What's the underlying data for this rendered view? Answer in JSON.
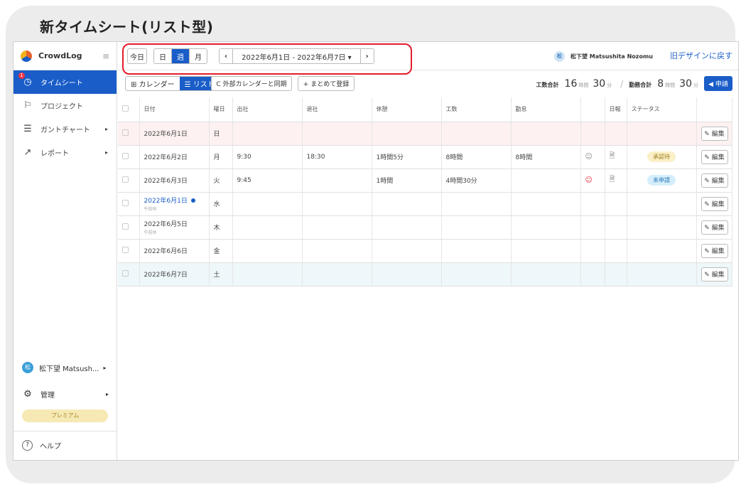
{
  "page_title": "新タイムシート(リスト型)",
  "sidebar": {
    "logo": "CrowdLog",
    "items": [
      {
        "label": "タイムシート",
        "icon": "clock-icon",
        "active": true,
        "badge": "1"
      },
      {
        "label": "プロジェクト",
        "icon": "flag-icon"
      },
      {
        "label": "ガントチャート",
        "icon": "gantt-icon",
        "chevron": "▸"
      },
      {
        "label": "レポート",
        "icon": "trend-icon",
        "chevron": "▸"
      }
    ],
    "user": {
      "avatar": "松",
      "name": "松下望 Matsush...",
      "chevron": "▸"
    },
    "admin": {
      "label": "管理",
      "chevron": "▸"
    },
    "premium": "プレミアム",
    "help": "ヘルプ"
  },
  "topbar": {
    "today": "今日",
    "views": [
      "日",
      "週",
      "月"
    ],
    "active_view": "週",
    "prev": "‹",
    "next": "›",
    "range": "2022年6月1日 - 2022年6月7日 ▾",
    "user_avatar": "松",
    "user_name": "松下望 Matsushita Nozomu",
    "old_design": "旧デザインに戻す"
  },
  "toolbar": {
    "calendar": "⊞ カレンダー",
    "list": "☰ リスト",
    "sync": "C 外部カレンダーと同期",
    "bulk": "+ まとめて登録",
    "work_total_label": "工数合計",
    "work_hours": "16",
    "work_minutes": "30",
    "attend_total_label": "勤務合計",
    "attend_hours": "8",
    "attend_minutes": "30",
    "hour_unit": "時間",
    "min_unit": "分",
    "apply": "◀ 申請"
  },
  "table": {
    "headers": [
      "",
      "日付",
      "曜日",
      "出社",
      "退社",
      "休憩",
      "工数",
      "勤怠",
      "",
      "日報",
      "ステータス",
      ""
    ],
    "edit_label": "✎ 編集",
    "rows": [
      {
        "date": "2022年6月1日",
        "dow": "日",
        "in": "",
        "out": "",
        "break": "",
        "work": "",
        "attend": "",
        "face": "",
        "doc": "",
        "status": "",
        "type": "sun"
      },
      {
        "date": "2022年6月2日",
        "dow": "月",
        "in": "9:30",
        "out": "18:30",
        "break": "1時間5分",
        "work": "8時間",
        "attend": "8時間",
        "face": "☺",
        "doc": "🗎",
        "status": "承認待",
        "type": ""
      },
      {
        "date": "2022年6月3日",
        "dow": "火",
        "in": "9:45",
        "out": "",
        "break": "1時間",
        "work": "4時間30分",
        "attend": "",
        "face": "☺",
        "doc": "🗎",
        "status": "未申請",
        "type": ""
      },
      {
        "date": "2022年6月1日",
        "sub": "午前休",
        "dow": "水",
        "in": "",
        "out": "",
        "break": "",
        "work": "",
        "attend": "",
        "face": "",
        "doc": "",
        "status": "",
        "type": "blue"
      },
      {
        "date": "2022年6月5日",
        "sub": "午前休",
        "dow": "木",
        "in": "",
        "out": "",
        "break": "",
        "work": "",
        "attend": "",
        "face": "",
        "doc": "",
        "status": "",
        "type": ""
      },
      {
        "date": "2022年6月6日",
        "dow": "金",
        "in": "",
        "out": "",
        "break": "",
        "work": "",
        "attend": "",
        "face": "",
        "doc": "",
        "status": "",
        "type": ""
      },
      {
        "date": "2022年6月7日",
        "dow": "土",
        "in": "",
        "out": "",
        "break": "",
        "work": "",
        "attend": "",
        "face": "",
        "doc": "",
        "status": "",
        "type": "sat"
      }
    ]
  }
}
